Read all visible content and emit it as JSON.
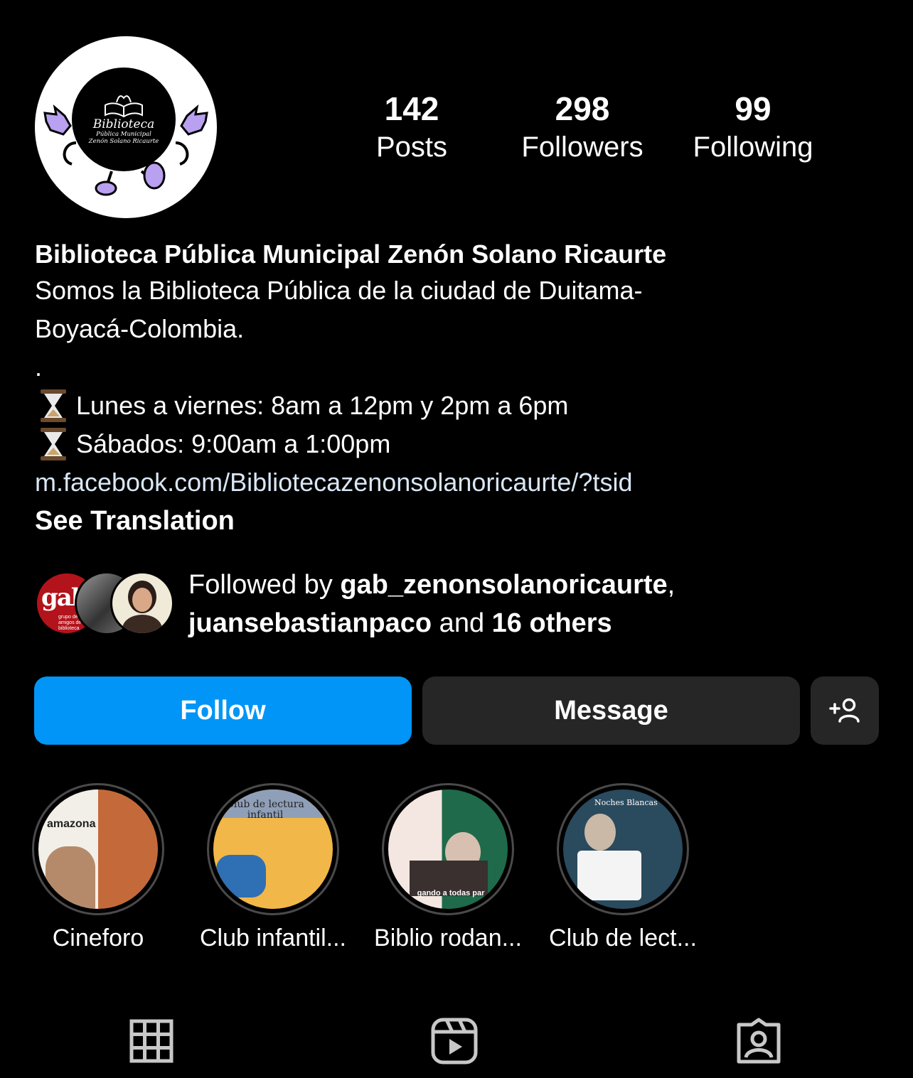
{
  "profile": {
    "logo_text": {
      "title": "Biblioteca",
      "line1": "Pública Municipal",
      "line2": "Zenón Solano Ricaurte"
    },
    "stats": [
      {
        "value": "142",
        "label": "Posts"
      },
      {
        "value": "298",
        "label": "Followers"
      },
      {
        "value": "99",
        "label": "Following"
      }
    ],
    "name": "Biblioteca Pública Municipal Zenón Solano Ricaurte",
    "bio_line1": "Somos la Biblioteca Pública de la ciudad de Duitama-",
    "bio_line2": "Boyacá-Colombia.",
    "bio_dot": ".",
    "hours_weekday": "Lunes a viernes: 8am a 12pm y 2pm a 6pm",
    "hours_saturday": "Sábados: 9:00am a 1:00pm",
    "link": "m.facebook.com/Bibliotecazenonsolanoricaurte/?tsid",
    "see_translation": "See Translation"
  },
  "followed_by": {
    "prefix": "Followed by ",
    "user1": "gab_zenonsolanoricaurte",
    "sep": ",",
    "user2": "juansebastianpaco",
    "mid": " and ",
    "others": "16 others",
    "avatar1_text": "galb",
    "avatar1_sub": "grupo de amigos de la biblioteca"
  },
  "actions": {
    "follow": "Follow",
    "message": "Message"
  },
  "highlights": [
    {
      "label": "Cineforo",
      "thumb_text": "amazona"
    },
    {
      "label": "Club infantil...",
      "thumb_text": "Club de lectura infantil"
    },
    {
      "label": "Biblio rodan...",
      "thumb_text": "gando a todas par"
    },
    {
      "label": "Club de lect...",
      "thumb_text": "Noches Blancas"
    }
  ],
  "icons": {
    "hourglass": "hourglass-icon",
    "add_person": "add-person-icon",
    "grid": "grid-icon",
    "reels": "reels-icon",
    "tagged": "tagged-icon"
  },
  "colors": {
    "background": "#000000",
    "follow_button": "#0095f6",
    "secondary_button": "#262626",
    "link": "#d9e6f5",
    "logo_accent": "#b9a0f0"
  }
}
